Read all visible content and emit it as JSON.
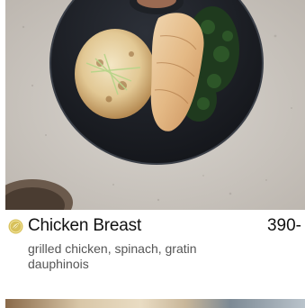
{
  "item": {
    "name": "Chicken Breast",
    "price": "390-",
    "description": "grilled chicken, spinach, gratin dauphinois",
    "badge_icon": "leaf-badge-icon",
    "photo": "plated-chicken-breast-photo"
  },
  "colors": {
    "badge": "#d8c15a",
    "name_text": "#111111",
    "description_text": "#555555"
  }
}
